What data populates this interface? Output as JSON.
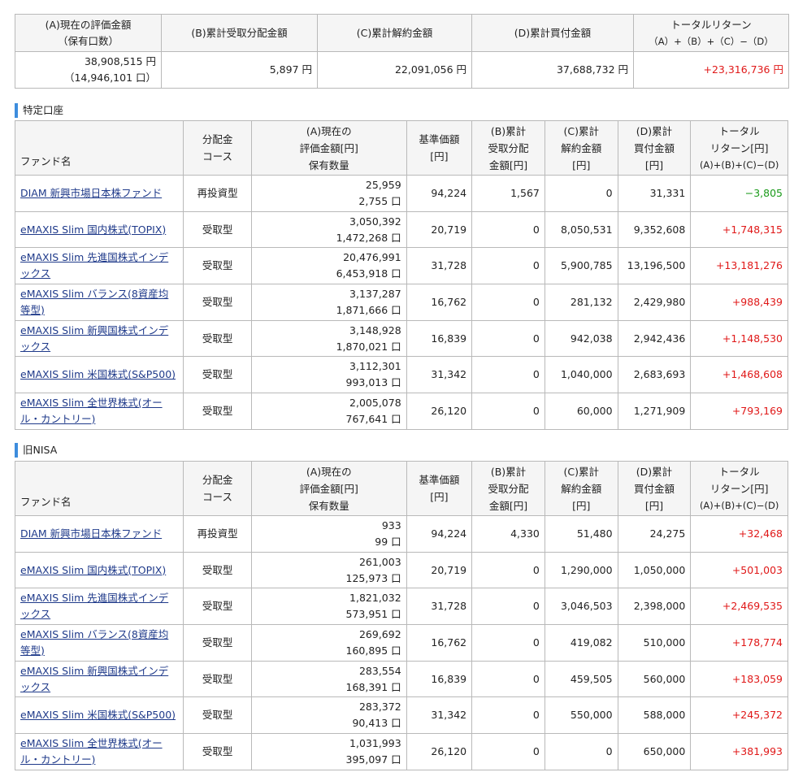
{
  "summary": {
    "headers": {
      "a_line1": "(A)現在の評価金額",
      "a_line2": "（保有口数）",
      "b": "(B)累計受取分配金額",
      "c": "(C)累計解約金額",
      "d": "(D)累計買付金額",
      "total_line1": "トータルリターン",
      "total_line2": "（A）+（B）+（C）−（D）"
    },
    "values": {
      "a_amount": "38,908,515 円",
      "a_units": "（14,946,101 口）",
      "b": "5,897 円",
      "c": "22,091,056 円",
      "d": "37,688,732 円",
      "total": "+23,316,736 円"
    }
  },
  "sections": [
    {
      "label": "特定口座",
      "header": {
        "fund": "ファンド名",
        "course_l1": "分配金",
        "course_l2": "コース",
        "a_l1": "(A)現在の",
        "a_l2": "評価金額[円]",
        "a_l3": "保有数量",
        "base_l1": "基準価額",
        "base_l2": "[円]",
        "b_l1": "(B)累計",
        "b_l2": "受取分配",
        "b_l3": "金額[円]",
        "c_l1": "(C)累計",
        "c_l2": "解約金額",
        "c_l3": "[円]",
        "d_l1": "(D)累計",
        "d_l2": "買付金額",
        "d_l3": "[円]",
        "t_l1": "トータル",
        "t_l2": "リターン[円]",
        "t_l3": "(A)+(B)+(C)−(D)"
      },
      "rows": [
        {
          "name": "DIAM 新興市場日本株ファンド",
          "course": "再投資型",
          "value": "25,959",
          "units": "2,755 口",
          "base": "94,224",
          "b": "1,567",
          "c": "0",
          "d": "31,331",
          "total": "−3,805",
          "sign": "neg"
        },
        {
          "name": "eMAXIS Slim 国内株式(TOPIX)",
          "course": "受取型",
          "value": "3,050,392",
          "units": "1,472,268 口",
          "base": "20,719",
          "b": "0",
          "c": "8,050,531",
          "d": "9,352,608",
          "total": "+1,748,315",
          "sign": "pos"
        },
        {
          "name": "eMAXIS Slim 先進国株式インデックス",
          "course": "受取型",
          "value": "20,476,991",
          "units": "6,453,918 口",
          "base": "31,728",
          "b": "0",
          "c": "5,900,785",
          "d": "13,196,500",
          "total": "+13,181,276",
          "sign": "pos"
        },
        {
          "name": "eMAXIS Slim バランス(8資産均等型)",
          "course": "受取型",
          "value": "3,137,287",
          "units": "1,871,666 口",
          "base": "16,762",
          "b": "0",
          "c": "281,132",
          "d": "2,429,980",
          "total": "+988,439",
          "sign": "pos"
        },
        {
          "name": "eMAXIS Slim 新興国株式インデックス",
          "course": "受取型",
          "value": "3,148,928",
          "units": "1,870,021 口",
          "base": "16,839",
          "b": "0",
          "c": "942,038",
          "d": "2,942,436",
          "total": "+1,148,530",
          "sign": "pos"
        },
        {
          "name": "eMAXIS Slim 米国株式(S&P500)",
          "course": "受取型",
          "value": "3,112,301",
          "units": "993,013 口",
          "base": "31,342",
          "b": "0",
          "c": "1,040,000",
          "d": "2,683,693",
          "total": "+1,468,608",
          "sign": "pos"
        },
        {
          "name": "eMAXIS Slim 全世界株式(オール・カントリー)",
          "course": "受取型",
          "value": "2,005,078",
          "units": "767,641 口",
          "base": "26,120",
          "b": "0",
          "c": "60,000",
          "d": "1,271,909",
          "total": "+793,169",
          "sign": "pos"
        }
      ]
    },
    {
      "label": "旧NISA",
      "header": {
        "fund": "ファンド名",
        "course_l1": "分配金",
        "course_l2": "コース",
        "a_l1": "(A)現在の",
        "a_l2": "評価金額[円]",
        "a_l3": "保有数量",
        "base_l1": "基準価額",
        "base_l2": "[円]",
        "b_l1": "(B)累計",
        "b_l2": "受取分配",
        "b_l3": "金額[円]",
        "c_l1": "(C)累計",
        "c_l2": "解約金額",
        "c_l3": "[円]",
        "d_l1": "(D)累計",
        "d_l2": "買付金額",
        "d_l3": "[円]",
        "t_l1": "トータル",
        "t_l2": "リターン[円]",
        "t_l3": "(A)+(B)+(C)−(D)"
      },
      "rows": [
        {
          "name": "DIAM 新興市場日本株ファンド",
          "course": "再投資型",
          "value": "933",
          "units": "99 口",
          "base": "94,224",
          "b": "4,330",
          "c": "51,480",
          "d": "24,275",
          "total": "+32,468",
          "sign": "pos"
        },
        {
          "name": "eMAXIS Slim 国内株式(TOPIX)",
          "course": "受取型",
          "value": "261,003",
          "units": "125,973 口",
          "base": "20,719",
          "b": "0",
          "c": "1,290,000",
          "d": "1,050,000",
          "total": "+501,003",
          "sign": "pos"
        },
        {
          "name": "eMAXIS Slim 先進国株式インデックス",
          "course": "受取型",
          "value": "1,821,032",
          "units": "573,951 口",
          "base": "31,728",
          "b": "0",
          "c": "3,046,503",
          "d": "2,398,000",
          "total": "+2,469,535",
          "sign": "pos"
        },
        {
          "name": "eMAXIS Slim バランス(8資産均等型)",
          "course": "受取型",
          "value": "269,692",
          "units": "160,895 口",
          "base": "16,762",
          "b": "0",
          "c": "419,082",
          "d": "510,000",
          "total": "+178,774",
          "sign": "pos"
        },
        {
          "name": "eMAXIS Slim 新興国株式インデックス",
          "course": "受取型",
          "value": "283,554",
          "units": "168,391 口",
          "base": "16,839",
          "b": "0",
          "c": "459,505",
          "d": "560,000",
          "total": "+183,059",
          "sign": "pos"
        },
        {
          "name": "eMAXIS Slim 米国株式(S&P500)",
          "course": "受取型",
          "value": "283,372",
          "units": "90,413 口",
          "base": "31,342",
          "b": "0",
          "c": "550,000",
          "d": "588,000",
          "total": "+245,372",
          "sign": "pos"
        },
        {
          "name": "eMAXIS Slim 全世界株式(オール・カントリー)",
          "course": "受取型",
          "value": "1,031,993",
          "units": "395,097 口",
          "base": "26,120",
          "b": "0",
          "c": "0",
          "d": "650,000",
          "total": "+381,993",
          "sign": "pos"
        }
      ]
    }
  ],
  "colors": {
    "positive": "#e01818",
    "negative": "#1a9a1a",
    "link": "#1f3a8a",
    "section_bar": "#3d8ddd",
    "header_bg": "#f5f5f5"
  }
}
